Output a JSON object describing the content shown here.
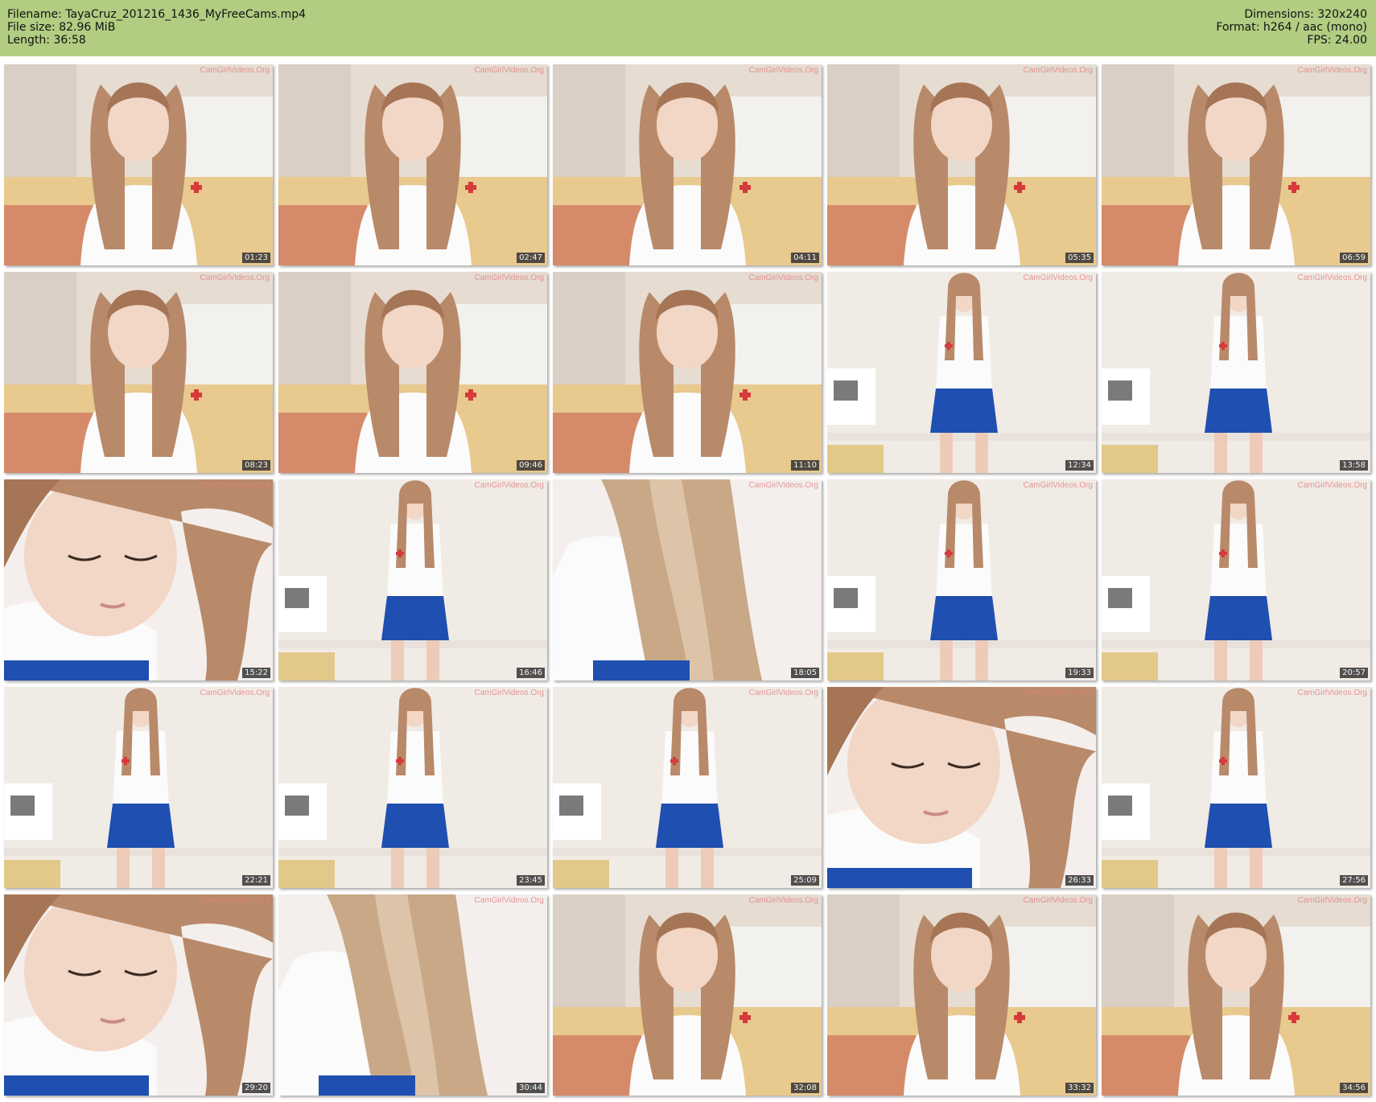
{
  "header": {
    "filename_label": "Filename:",
    "filename": "TayaCruz_201216_1436_MyFreeCams.mp4",
    "filesize_label": "File size:",
    "filesize": "82.96 MiB",
    "length_label": "Length:",
    "length": "36:58",
    "dimensions_label": "Dimensions:",
    "dimensions": "320x240",
    "format_label": "Format:",
    "format": "h264 / aac (mono)",
    "fps_label": "FPS:",
    "fps": "24.00",
    "background_color": "#b0cd81"
  },
  "thumbnails": [
    {
      "time": "01:23",
      "scene": "bedroom-closeup",
      "watermark": "CamGirlVideos.Org"
    },
    {
      "time": "02:47",
      "scene": "bedroom-closeup",
      "watermark": "CamGirlVideos.Org"
    },
    {
      "time": "04:11",
      "scene": "bedroom-closeup",
      "watermark": "CamGirlVideos.Org"
    },
    {
      "time": "05:35",
      "scene": "bedroom-closeup",
      "watermark": "CamGirlVideos.Org"
    },
    {
      "time": "06:59",
      "scene": "bedroom-closeup",
      "watermark": "CamGirlVideos.Org"
    },
    {
      "time": "08:23",
      "scene": "bedroom-closeup",
      "watermark": "CamGirlVideos.Org"
    },
    {
      "time": "09:46",
      "scene": "bedroom-closeup",
      "watermark": "CamGirlVideos.Org"
    },
    {
      "time": "11:10",
      "scene": "bedroom-closeup",
      "watermark": "CamGirlVideos.Org"
    },
    {
      "time": "12:34",
      "scene": "standing",
      "watermark": "CamGirlVideos.Org"
    },
    {
      "time": "13:58",
      "scene": "standing",
      "watermark": "CamGirlVideos.Org"
    },
    {
      "time": "15:22",
      "scene": "face-closeup",
      "watermark": "CamGirlVideos.Org"
    },
    {
      "time": "16:46",
      "scene": "standing",
      "watermark": "CamGirlVideos.Org"
    },
    {
      "time": "18:05",
      "scene": "hair-closeup",
      "watermark": "CamGirlVideos.Org"
    },
    {
      "time": "19:33",
      "scene": "standing",
      "watermark": "CamGirlVideos.Org"
    },
    {
      "time": "20:57",
      "scene": "standing",
      "watermark": "CamGirlVideos.Org"
    },
    {
      "time": "22:21",
      "scene": "standing",
      "watermark": "CamGirlVideos.Org"
    },
    {
      "time": "23:45",
      "scene": "standing",
      "watermark": "CamGirlVideos.Org"
    },
    {
      "time": "25:09",
      "scene": "standing",
      "watermark": "CamGirlVideos.Org"
    },
    {
      "time": "26:33",
      "scene": "face-closeup",
      "watermark": "CamGirlVideos.Org"
    },
    {
      "time": "27:56",
      "scene": "standing",
      "watermark": "CamGirlVideos.Org"
    },
    {
      "time": "29:20",
      "scene": "face-closeup",
      "watermark": "CamGirlVideos.Org"
    },
    {
      "time": "30:44",
      "scene": "hair-closeup",
      "watermark": "CamGirlVideos.Org"
    },
    {
      "time": "32:08",
      "scene": "bedroom-closeup",
      "watermark": "CamGirlVideos.Org"
    },
    {
      "time": "33:32",
      "scene": "bedroom-closeup",
      "watermark": "CamGirlVideos.Org"
    },
    {
      "time": "34:56",
      "scene": "bedroom-closeup",
      "watermark": "CamGirlVideos.Org"
    }
  ]
}
